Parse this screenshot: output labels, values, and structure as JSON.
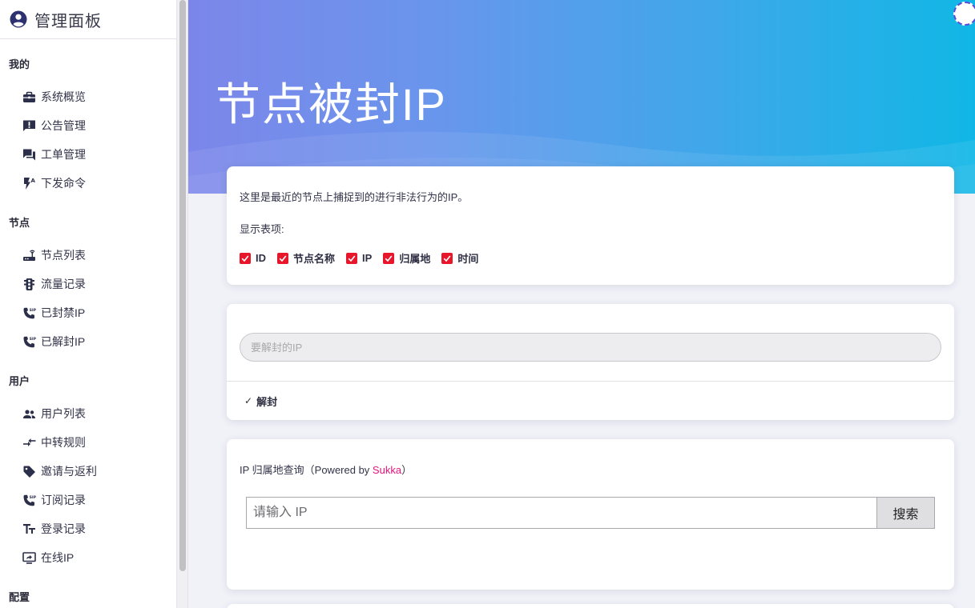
{
  "brand": {
    "title": "管理面板",
    "icon": "account-circle-icon"
  },
  "sidebar": {
    "sections": [
      {
        "title": "我的",
        "items": [
          {
            "label": "系统概览",
            "icon": "briefcase-icon"
          },
          {
            "label": "公告管理",
            "icon": "announcement-icon"
          },
          {
            "label": "工单管理",
            "icon": "forum-icon"
          },
          {
            "label": "下发命令",
            "icon": "flash-auto-icon"
          }
        ]
      },
      {
        "title": "节点",
        "items": [
          {
            "label": "节点列表",
            "icon": "router-icon"
          },
          {
            "label": "流量记录",
            "icon": "traffic-icon"
          },
          {
            "label": "已封禁IP",
            "icon": "phone-sip-icon"
          },
          {
            "label": "已解封IP",
            "icon": "phone-sip-icon"
          }
        ]
      },
      {
        "title": "用户",
        "items": [
          {
            "label": "用户列表",
            "icon": "people-icon"
          },
          {
            "label": "中转规则",
            "icon": "transfer-icon"
          },
          {
            "label": "邀请与返利",
            "icon": "tag-icon"
          },
          {
            "label": "订阅记录",
            "icon": "phone-sip-icon"
          },
          {
            "label": "登录记录",
            "icon": "text-fields-icon"
          },
          {
            "label": "在线IP",
            "icon": "screen-share-icon"
          }
        ]
      },
      {
        "title": "配置"
      }
    ]
  },
  "page": {
    "title": "节点被封IP"
  },
  "info_card": {
    "description": "这里是最近的节点上捕捉到的进行非法行为的IP。",
    "columns_label": "显示表项:",
    "columns": [
      {
        "label": "ID",
        "checked": true
      },
      {
        "label": "节点名称",
        "checked": true
      },
      {
        "label": "IP",
        "checked": true
      },
      {
        "label": "归属地",
        "checked": true
      },
      {
        "label": "时间",
        "checked": true
      }
    ]
  },
  "unban_card": {
    "placeholder": "要解封的IP",
    "value": "",
    "button_label": "解封",
    "button_icon": "check-icon"
  },
  "lookup_card": {
    "title_prefix": "IP 归属地查询（Powered by ",
    "brand": "Sukka",
    "title_suffix": "）",
    "placeholder": "请输入 IP",
    "value": "",
    "search_label": "搜索"
  },
  "colors": {
    "checkbox": "#e8162b",
    "link": "#e0157a",
    "hero_start": "#7c86ea",
    "hero_end": "#10b7e6",
    "background": "#f1f2f8"
  }
}
